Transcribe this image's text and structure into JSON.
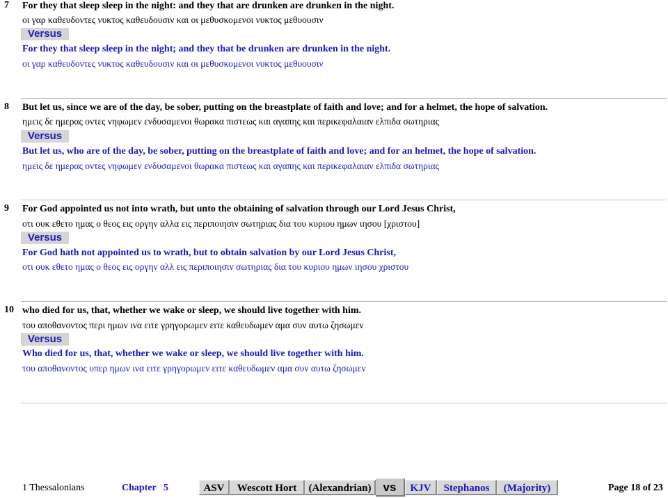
{
  "verses": [
    {
      "number": "7",
      "kjv_text": "For they that sleep sleep in the night: and they that are drunken are drunken in the night.",
      "greek_1": "οι γαρ καθευδοντες νυκτος καθευδουσιν και οι μεθυσκομενοι νυκτος μεθυουσιν",
      "versus_label": "Versus",
      "alt_text": "For they that sleep sleep in the night; and they that be drunken are drunken in the night.",
      "greek_2": "οι γαρ καθευδοντες νυκτος καθευδουσιν και οι μεθυσκομενοι νυκτος μεθυουσιν"
    },
    {
      "number": "8",
      "kjv_text": "But let us, since we are of the day, be sober, putting on the breastplate of faith and love; and for a helmet, the hope of salvation.",
      "greek_1": "ημεις δε ημερας οντες νηφωμεν ενδυσαμενοι θωρακα πιστεως και αγαπης και περικεφαλαιαν ελπιδα σωτηριας",
      "versus_label": "Versus",
      "alt_text": "But let us, who are of the day, be sober, putting on the breastplate of faith and love; and for an helmet, the hope of salvation.",
      "greek_2": "ημεις δε ημερας οντες νηφωμεν ενδυσαμενοι θωρακα πιστεως και αγαπης και περικεφαλαιαν ελπιδα σωτηριας"
    },
    {
      "number": "9",
      "kjv_text": "For God appointed us not into wrath, but unto the obtaining of salvation through our Lord Jesus Christ,",
      "greek_1": "οτι ουκ εθετο ημας ο θεος εις οργην αλλα εις περιποιησιν σωτηριας δια του κυριου ημων ιησου [χριστου]",
      "versus_label": "Versus",
      "alt_text": "For God hath not appointed us to wrath, but to obtain salvation by our Lord Jesus Christ,",
      "greek_2": "οτι ουκ εθετο ημας ο θεος εις οργην αλλ εις περιποιησιν σωτηριας δια του κυριου ημων ιησου χριστου"
    },
    {
      "number": "10",
      "kjv_text": "who died for us, that, whether we wake or sleep, we should live together with him.",
      "greek_1": "του αποθανοντος περι ημων ινα ειτε γρηγορωμεν ειτε καθευδωμεν αμα συν αυτω ζησωμεν",
      "versus_label": "Versus",
      "alt_text": "Who died for us, that, whether we wake or sleep, we should live together with him.",
      "greek_2": "του αποθανοντος υπερ ημων ινα ειτε γρηγορωμεν ειτε καθευδωμεν αμα συν αυτω ζησωμεν"
    }
  ],
  "footer": {
    "book": "1 Thessalonians",
    "chapter_label": "Chapter",
    "chapter_number": "5",
    "tabs_left": [
      "ASV",
      "Wescott Hort",
      "(Alexandrian)"
    ],
    "vs_label": "vs",
    "tabs_right": [
      "KJV",
      "Stephanos",
      "(Majority)"
    ],
    "page_info": "Page 18 of 23"
  },
  "colors": {
    "text": "#000000",
    "comparison_text": "#1a1ab8",
    "versus_bg": "#d5d5d5",
    "tab_bg": "#d8d8d8"
  }
}
